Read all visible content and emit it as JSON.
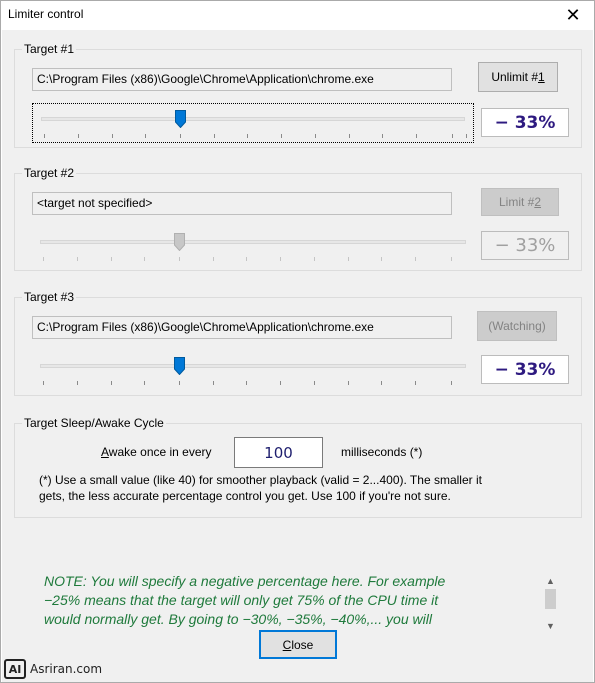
{
  "window": {
    "title": "Limiter control",
    "close_glyph": "✕"
  },
  "targets": [
    {
      "label": "Target #1",
      "path": "C:\\Program Files (x86)\\Google\\Chrome\\Application\\chrome.exe",
      "button_pre": "Unlimit #",
      "button_key": "1",
      "button_enabled": true,
      "percent": "− 33%",
      "slider_position": 0.33
    },
    {
      "label": "Target #2",
      "path": "<target not specified>",
      "button_pre": "Limit #",
      "button_key": "2",
      "button_enabled": false,
      "percent": "− 33%",
      "slider_position": 0.33
    },
    {
      "label": "Target #3",
      "path": "C:\\Program Files (x86)\\Google\\Chrome\\Application\\chrome.exe",
      "button_label": "(Watching)",
      "button_enabled": false,
      "percent": "− 33%",
      "slider_position": 0.33
    }
  ],
  "cycle": {
    "label": "Target Sleep/Awake Cycle",
    "awake_key": "A",
    "awake_rest": "wake once in every",
    "value": "100",
    "unit": "milliseconds (*)",
    "help_line1": "(*) Use a small value (like 40) for smoother playback (valid = 2...400).  The smaller it",
    "help_line2": "gets, the less accurate percentage control you get.  Use 100 if you're not sure."
  },
  "note": {
    "line1": "NOTE:  You will specify a negative percentage here.  For example",
    "line2": "−25% means that the target will only get 75% of the CPU time it",
    "line3": "would normally get.  By going to −30%, −35%, −40%,... you will"
  },
  "close_button": {
    "key": "C",
    "rest": "lose"
  },
  "watermark": {
    "logo": "AI",
    "text": "Asriran.com"
  },
  "colors": {
    "percent_text": "#2e1a80",
    "note_text": "#1f7a3c",
    "focus": "#0078d7"
  }
}
